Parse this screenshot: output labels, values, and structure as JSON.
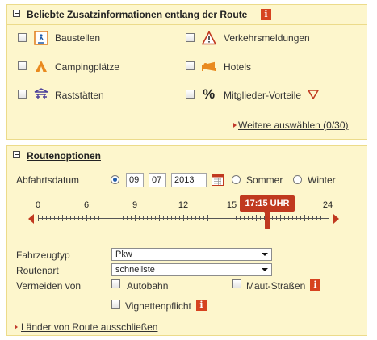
{
  "route_info": {
    "title": "Beliebte Zusatzinformationen entlang der Route",
    "items": [
      {
        "label": "Baustellen",
        "icon": "construction-icon"
      },
      {
        "label": "Verkehrsmeldungen",
        "icon": "warning-icon"
      },
      {
        "label": "Campingplätze",
        "icon": "tent-icon"
      },
      {
        "label": "Hotels",
        "icon": "hotel-bed-icon"
      },
      {
        "label": "Raststätten",
        "icon": "rest-area-icon"
      },
      {
        "label": "Mitglieder-Vorteile",
        "icon": "percent-icon"
      }
    ],
    "more_link": "Weitere auswählen (0/30)"
  },
  "route_options": {
    "title": "Routenoptionen",
    "date_label": "Abfahrtsdatum",
    "day": "09",
    "month": "07",
    "year": "2013",
    "summer_label": "Sommer",
    "winter_label": "Winter",
    "selected_season": "date",
    "slider": {
      "ticks": [
        "0",
        "6",
        "9",
        "12",
        "15",
        "24"
      ],
      "time_label": "17:15 UHR",
      "value_hours": 17.25
    },
    "vehicle_label": "Fahrzeugtyp",
    "vehicle_value": "Pkw",
    "route_type_label": "Routenart",
    "route_type_value": "schnellste",
    "avoid_label": "Vermeiden von",
    "avoid": {
      "autobahn": "Autobahn",
      "toll": "Maut-Straßen",
      "vignette": "Vignettenpflicht"
    },
    "exclude_link": "Länder von Route ausschließen"
  },
  "colors": {
    "accent": "#c0391f",
    "panel_bg": "#fdf6cc",
    "panel_border": "#ecdb8a",
    "radio_selected": "#1e5aa8"
  }
}
